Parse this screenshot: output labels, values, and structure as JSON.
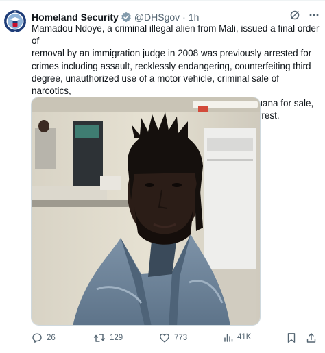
{
  "account": {
    "name": "Homeland Security",
    "handle": "@DHSgov",
    "separator": "·",
    "time": "1h",
    "verified_icon": "gov-badge-icon",
    "avatar_icon": "dhs-seal-icon"
  },
  "tweet": {
    "text": "Mamadou Ndoye, a criminal illegal alien from Mali, issued a final order of\nremoval by an immigration judge in 2008 was previously arrested for\ncrimes including assault, recklessly endangering, counterfeiting third\ndegree, unauthorized use of a motor vehicle, criminal sale of narcotics,\npossessing a controlled substance, possession of marijuana for sale,\nmaking false reports to law enforcement and resisting arrest."
  },
  "actions": {
    "replies": "26",
    "reposts": "129",
    "likes": "773",
    "views": "41K"
  },
  "colors": {
    "text": "#0f1419",
    "muted": "#536471",
    "border": "#cfd9de",
    "seal_blue": "#1d3c78"
  }
}
